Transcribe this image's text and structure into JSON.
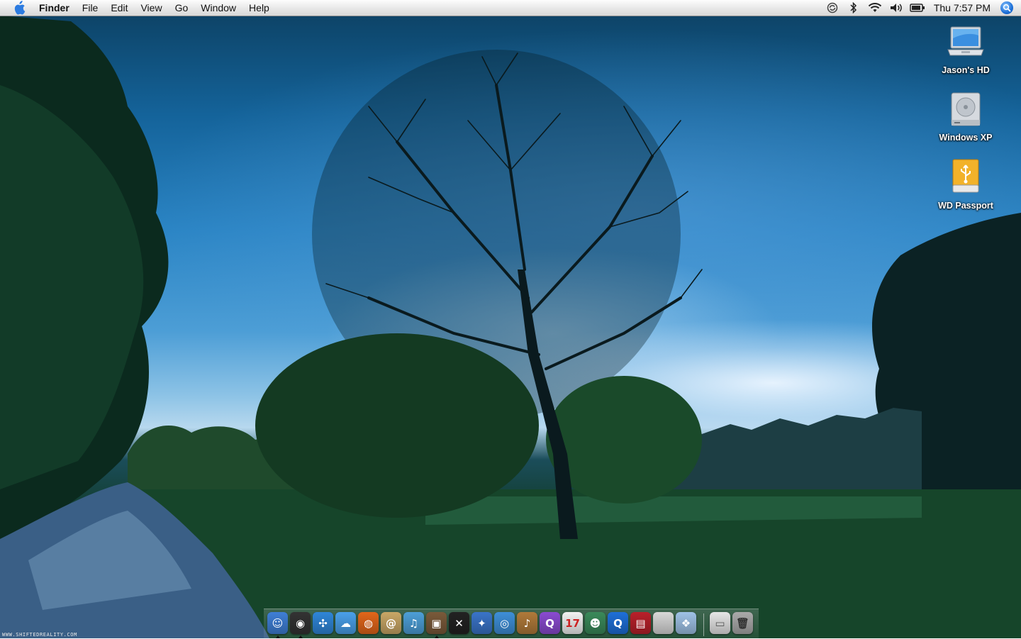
{
  "menubar": {
    "app_name": "Finder",
    "menus": [
      "File",
      "Edit",
      "View",
      "Go",
      "Window",
      "Help"
    ],
    "status_icons": [
      "sync-icon",
      "bluetooth-icon",
      "wifi-icon",
      "volume-icon",
      "battery-icon"
    ],
    "clock": "Thu 7:57 PM"
  },
  "desktop_icons": [
    {
      "label": "Jason's HD",
      "icon": "laptop-drive-icon"
    },
    {
      "label": "Windows XP",
      "icon": "hard-drive-icon"
    },
    {
      "label": "WD Passport",
      "icon": "usb-drive-icon"
    }
  ],
  "dock": {
    "items": [
      {
        "icon": "finder-icon",
        "color": "#3f7fd6",
        "glyph": "☺"
      },
      {
        "icon": "dvd-player-icon",
        "color": "#333333",
        "glyph": "◉"
      },
      {
        "icon": "safari-icon",
        "color": "#2f86d8",
        "glyph": "✣"
      },
      {
        "icon": "ichat-icon",
        "color": "#4aa0ea",
        "glyph": "☁"
      },
      {
        "icon": "firefox-icon",
        "color": "#e2661a",
        "glyph": "◍"
      },
      {
        "icon": "mail-icon",
        "color": "#c9a766",
        "glyph": "@"
      },
      {
        "icon": "itunes-icon",
        "color": "#4d9fd8",
        "glyph": "♫"
      },
      {
        "icon": "iphoto-icon",
        "color": "#7a5a3a",
        "glyph": "▣"
      },
      {
        "icon": "x11-icon",
        "color": "#222222",
        "glyph": "✕"
      },
      {
        "icon": "imovie-icon",
        "color": "#3a74c8",
        "glyph": "✦"
      },
      {
        "icon": "idvd-icon",
        "color": "#3e8fd8",
        "glyph": "◎"
      },
      {
        "icon": "garageband-icon",
        "color": "#b07a3a",
        "glyph": "♪"
      },
      {
        "icon": "quicksilver-icon",
        "color": "#8a4bd0",
        "glyph": "Q"
      },
      {
        "icon": "ical-icon",
        "color": "#f2f2f2",
        "glyph": "17"
      },
      {
        "icon": "messenger-icon",
        "color": "#3a8a5a",
        "glyph": "☻"
      },
      {
        "icon": "quicktime-icon",
        "color": "#1e6fd8",
        "glyph": "Q"
      },
      {
        "icon": "photo-booth-icon",
        "color": "#b8202a",
        "glyph": "▤"
      },
      {
        "icon": "system-preferences-icon",
        "color": "#d8d8d8",
        "glyph": ""
      },
      {
        "icon": "preview-icon",
        "color": "#9fc2e6",
        "glyph": "❖"
      }
    ],
    "extras": [
      {
        "icon": "downloads-folder-icon",
        "color": "#e6e6e6",
        "glyph": "▭"
      },
      {
        "icon": "trash-icon",
        "color": "#aaaaaa",
        "glyph": "🗑"
      }
    ]
  },
  "watermark": "WWW.SHIFTEDREALITY.COM",
  "colors": {
    "spotlight": "#1c6fd8",
    "menubar": "#e7e7e7"
  }
}
